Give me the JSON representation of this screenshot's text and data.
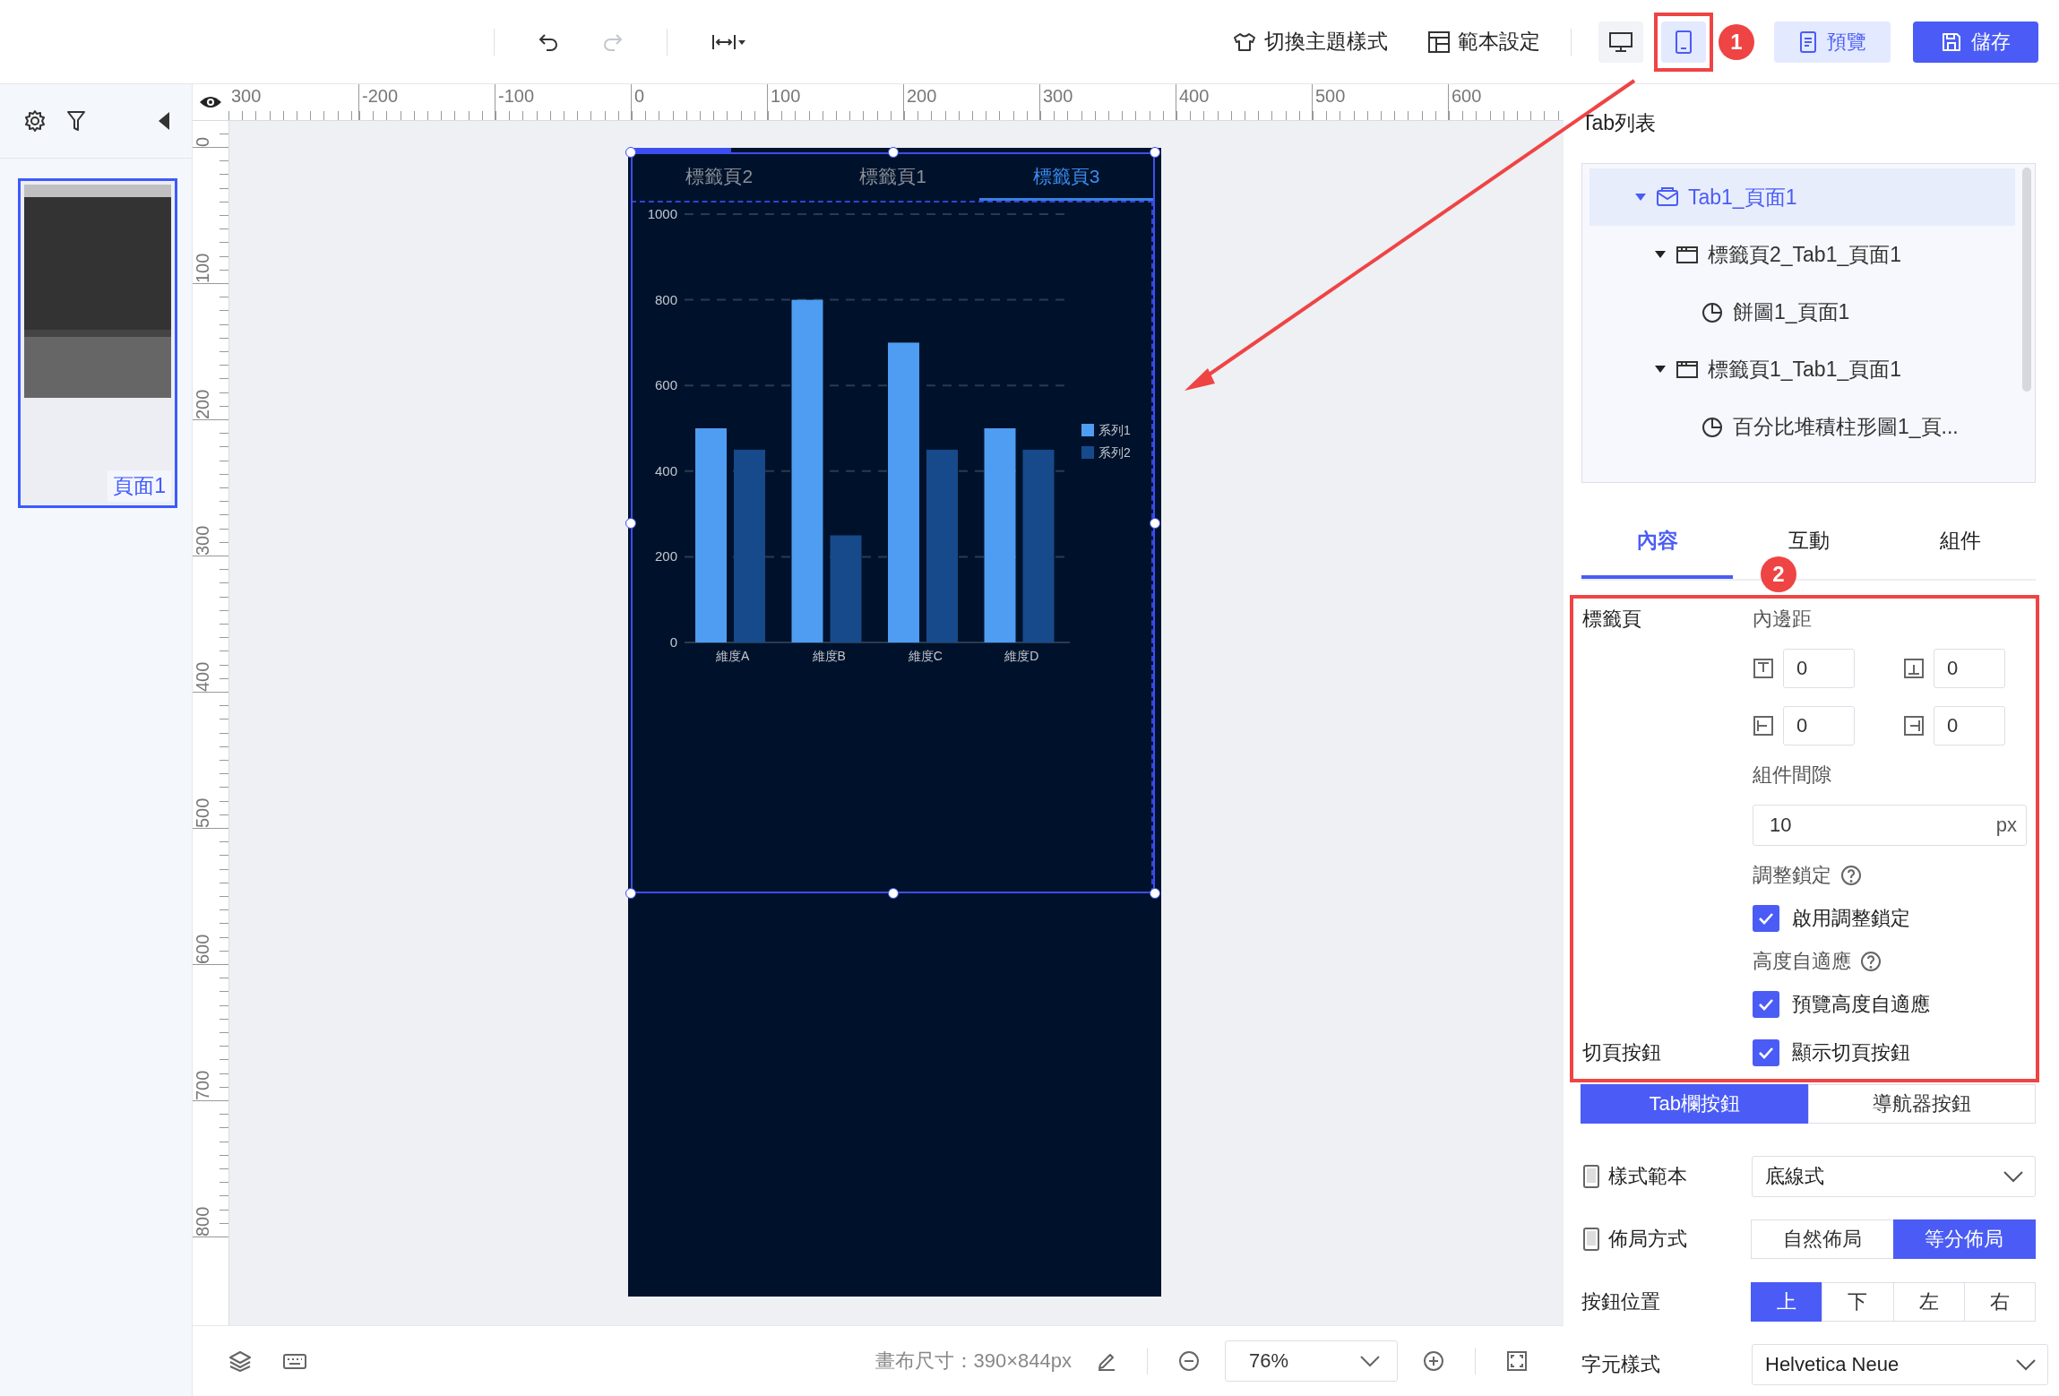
{
  "toolbar": {
    "history": [
      {
        "kind": "undo",
        "disabled": false
      },
      {
        "kind": "redo",
        "disabled": true
      }
    ],
    "theme_button": "切換主題樣式",
    "template_button": "範本設定",
    "device_modes": [
      {
        "kind": "desktop",
        "selected": false
      },
      {
        "kind": "mobile",
        "selected": true
      }
    ],
    "annotation_badge": "1",
    "preview_button": "預覽",
    "save_button": "儲存"
  },
  "sidebar": {
    "pages": [
      {
        "label": "頁面1",
        "selected": true
      }
    ]
  },
  "rulers": {
    "horizontal": [
      "300",
      "-200",
      "-100",
      "0",
      "100",
      "200",
      "300",
      "400",
      "500",
      "600"
    ],
    "vertical": [
      "0",
      "100",
      "200",
      "300",
      "400",
      "500",
      "600",
      "700",
      "800"
    ]
  },
  "canvas": {
    "tabs": [
      {
        "label": "標籤頁2",
        "selected": false
      },
      {
        "label": "標籤頁1",
        "selected": false
      },
      {
        "label": "標籤頁3",
        "selected": true
      }
    ],
    "chart_data": {
      "type": "bar",
      "categories": [
        "維度A",
        "維度B",
        "維度C",
        "維度D"
      ],
      "series": [
        {
          "name": "系列1",
          "color": "#4f9df2",
          "values": [
            500,
            800,
            700,
            500
          ]
        },
        {
          "name": "系列2",
          "color": "#174a8b",
          "values": [
            450,
            250,
            450,
            450
          ]
        }
      ],
      "ylim": [
        0,
        1000
      ],
      "yticks": [
        0,
        200,
        400,
        600,
        800,
        1000
      ],
      "grid": true,
      "legend": true
    }
  },
  "right_panel": {
    "tab_list_title": "Tab列表",
    "tree": [
      {
        "label": "Tab1_頁面1",
        "kind": "tabs",
        "expanded": true,
        "selected": true,
        "children": [
          {
            "label": "標籤頁2_Tab1_頁面1",
            "kind": "page",
            "expanded": true,
            "selected": false,
            "children": [
              {
                "label": "餅圖1_頁面1",
                "kind": "chart",
                "selected": false
              }
            ]
          },
          {
            "label": "標籤頁1_Tab1_頁面1",
            "kind": "page",
            "expanded": true,
            "selected": false,
            "children": [
              {
                "label": "百分比堆積柱形圖1_頁...",
                "kind": "chart",
                "selected": false
              }
            ]
          }
        ]
      }
    ],
    "tabs": [
      {
        "label": "內容",
        "selected": true
      },
      {
        "label": "互動",
        "selected": false
      },
      {
        "label": "組件",
        "selected": false
      }
    ],
    "annotation_badge": "2",
    "tab_page": {
      "label": "標籤頁",
      "padding_label": "內邊距",
      "padding": [
        {
          "kind": "top",
          "value": "0"
        },
        {
          "kind": "bottom",
          "value": "0"
        },
        {
          "kind": "left",
          "value": "0"
        },
        {
          "kind": "right",
          "value": "0"
        }
      ],
      "gap_label": "組件間隙",
      "gap": {
        "value": "10",
        "unit": "px"
      },
      "lock_label": "調整鎖定",
      "lock_checkbox": {
        "label": "啟用調整鎖定",
        "checked": true
      },
      "auto_height_label": "高度自適應",
      "auto_height_checkbox": {
        "label": "預覽高度自適應",
        "checked": true
      }
    },
    "page_button": {
      "label": "切頁按鈕",
      "checkbox": {
        "label": "顯示切頁按鈕",
        "checked": true
      }
    },
    "button_type": [
      {
        "label": "Tab欄按鈕",
        "selected": true
      },
      {
        "label": "導航器按鈕",
        "selected": false
      }
    ],
    "style_template": {
      "label": "樣式範本",
      "value": "底線式"
    },
    "layout": {
      "label": "佈局方式",
      "options": [
        {
          "label": "自然佈局",
          "selected": false
        },
        {
          "label": "等分佈局",
          "selected": true
        }
      ]
    },
    "button_position": {
      "label": "按鈕位置",
      "options": [
        {
          "label": "上",
          "selected": true
        },
        {
          "label": "下",
          "selected": false
        },
        {
          "label": "左",
          "selected": false
        },
        {
          "label": "右",
          "selected": false
        }
      ]
    },
    "font": {
      "label": "字元樣式",
      "value": "Helvetica Neue"
    }
  },
  "status_bar": {
    "canvas_size": "畫布尺寸：390×844px",
    "zoom": "76%"
  }
}
